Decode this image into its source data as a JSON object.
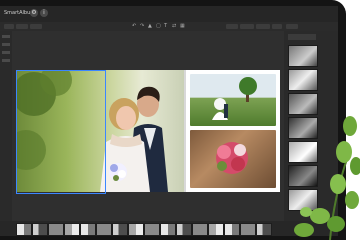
{
  "app": {
    "title": "SmartAlbums"
  },
  "window_icons": [
    "gear-icon",
    "info-icon"
  ],
  "menu": {
    "items": [
      "",
      "",
      "",
      "",
      "",
      "",
      "",
      ""
    ]
  },
  "page": {
    "label": ""
  },
  "colors": {
    "selection": "#3b86ff",
    "window_bg": "#2f2f2f",
    "leaf": "#6fa83a"
  }
}
